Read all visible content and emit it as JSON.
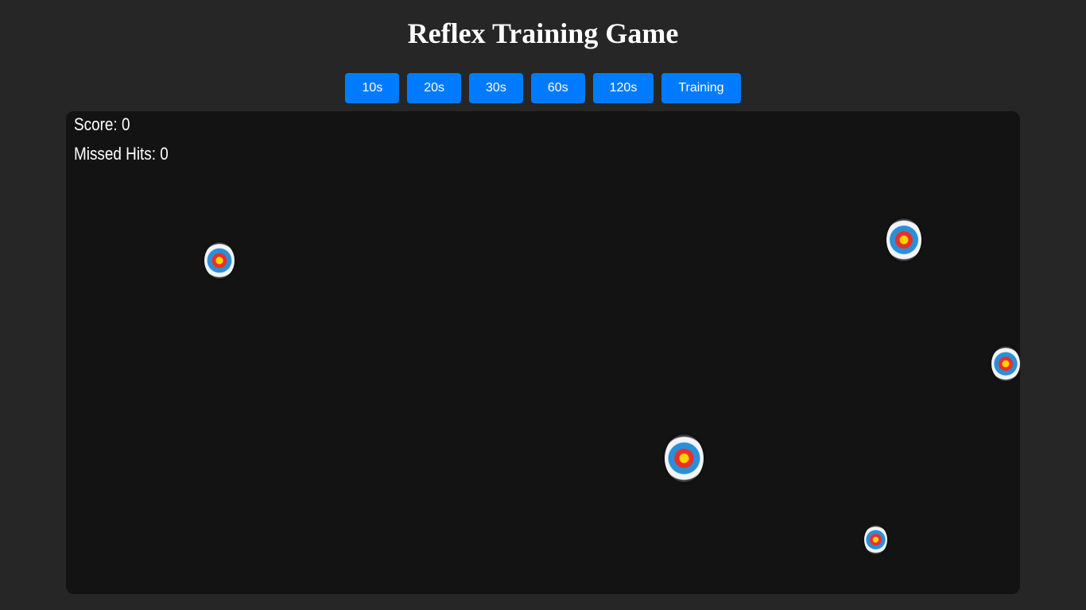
{
  "title": "Reflex Training Game",
  "modes": [
    {
      "label": "10s"
    },
    {
      "label": "20s"
    },
    {
      "label": "30s"
    },
    {
      "label": "60s"
    },
    {
      "label": "120s"
    },
    {
      "label": "Training"
    }
  ],
  "stats": {
    "score_text": "Score: 0",
    "missed_text": "Missed Hits: 0"
  },
  "targets": {
    "count": 5,
    "icon": "bullseye-target-icon"
  },
  "colors": {
    "page_background": "#262626",
    "arena_background": "#131313",
    "button": "#007bff",
    "button_text": "#ffffff",
    "text": "#ffffff",
    "target_center": "#ffd400",
    "target_red": "#e8302a",
    "target_blue": "#2a8fd8",
    "target_white": "#f2f4f7",
    "target_outer": "#2c2c2c"
  }
}
